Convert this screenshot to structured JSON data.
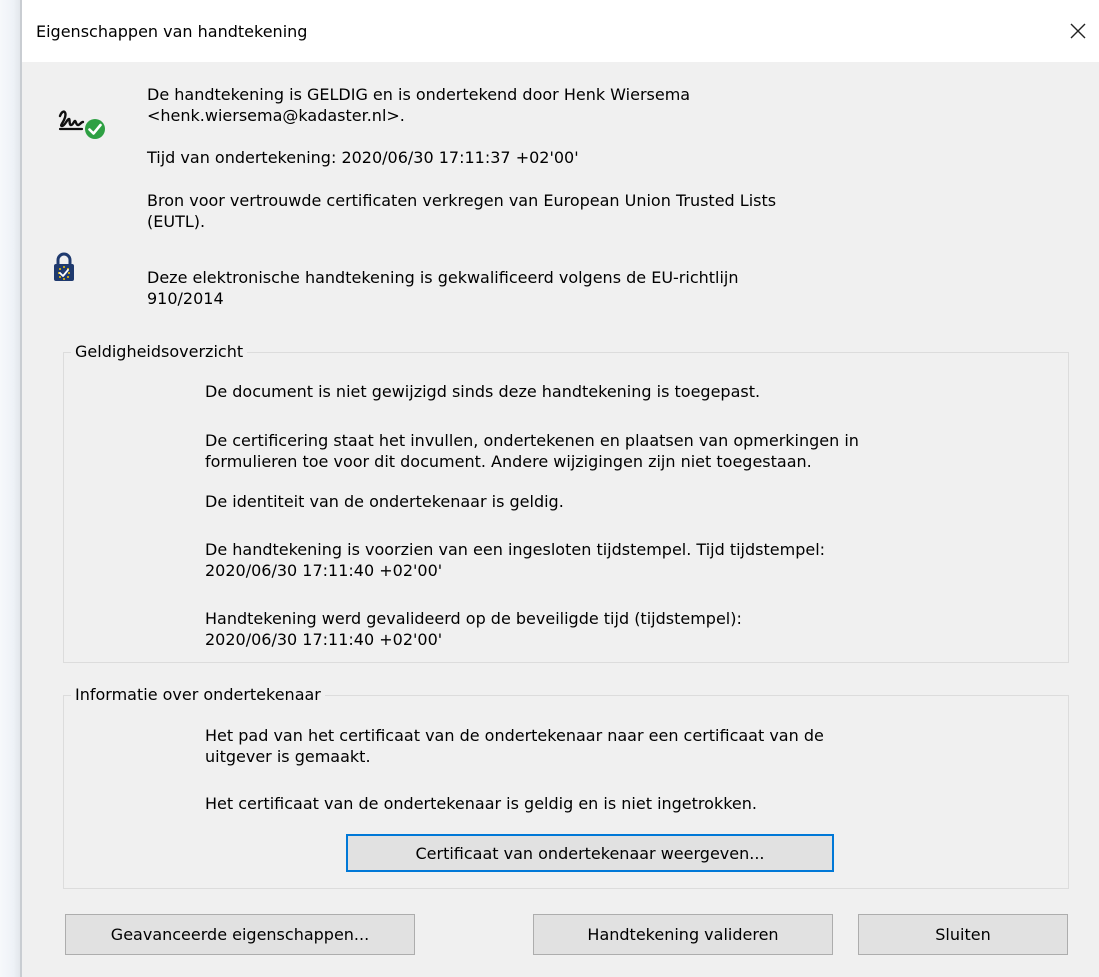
{
  "window": {
    "title": "Eigenschappen van handtekening"
  },
  "summary": {
    "status_line1": "De handtekening is GELDIG en is ondertekend door Henk Wiersema",
    "status_line2": "<henk.wiersema@kadaster.nl>.",
    "signing_time": "Tijd van ondertekening:  2020/06/30 17:11:37 +02'00'",
    "trust_source_line1": "Bron voor vertrouwde certificaten verkregen van European Union Trusted Lists",
    "trust_source_line2": "(EUTL).",
    "qualified_line1": "Deze elektronische handtekening is gekwalificeerd volgens de EU-richtlijn",
    "qualified_line2": "910/2014"
  },
  "validity": {
    "label": "Geldigheidsoverzicht",
    "items": [
      "De document is niet gewijzigd sinds deze handtekening is toegepast.",
      "De certificering staat het invullen, ondertekenen en plaatsen van opmerkingen in",
      "formulieren toe voor dit document. Andere wijzigingen zijn niet toegestaan.",
      "De identiteit van de ondertekenaar is geldig.",
      "De handtekening is voorzien van een ingesloten tijdstempel. Tijd tijdstempel:",
      "2020/06/30 17:11:40 +02'00'",
      "Handtekening werd gevalideerd op de beveiligde tijd (tijdstempel):",
      "2020/06/30 17:11:40 +02'00'"
    ]
  },
  "signer": {
    "label": "Informatie over ondertekenaar",
    "items": [
      "Het pad van het certificaat van de ondertekenaar naar een certificaat van de",
      "uitgever is gemaakt.",
      "Het certificaat van de ondertekenaar is geldig en is niet ingetrokken."
    ],
    "show_cert_button": "Certificaat van ondertekenaar weergeven..."
  },
  "footer": {
    "advanced_button": "Geavanceerde eigenschappen...",
    "validate_button": "Handtekening valideren",
    "close_button": "Sluiten"
  },
  "icons": {
    "close": "close-icon",
    "signature_valid": "signature-check-icon",
    "qualified": "eu-lock-icon"
  },
  "colors": {
    "dialog_bg": "#f0f0f0",
    "check_green": "#2ea043",
    "eu_blue": "#1f3a6e",
    "eu_star": "#f5c400",
    "focus_blue": "#0078d7"
  }
}
